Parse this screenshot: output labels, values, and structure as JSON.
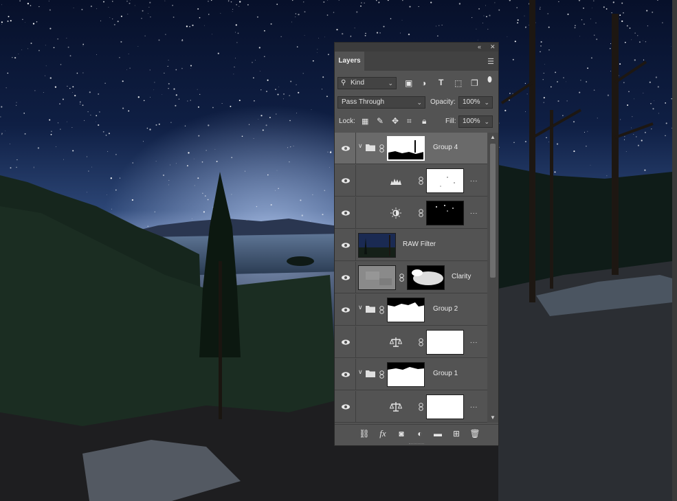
{
  "canvas": {
    "description_icon": "photo-night-lake-milky-way"
  },
  "panel": {
    "tab_label": "Layers",
    "collapse_icon": "double-chevron-left-icon",
    "close_icon": "close-icon",
    "menu_icon": "panel-menu-icon",
    "filter": {
      "kind_label": "Kind"
    },
    "blend_mode": "Pass Through",
    "opacity_label": "Opacity:",
    "opacity_value": "100%",
    "lock_label": "Lock:",
    "fill_label": "Fill:",
    "fill_value": "100%",
    "layers": [
      {
        "name": "Group 4",
        "type": "group",
        "selected": true
      },
      {
        "name": "",
        "type": "levels",
        "more": "..."
      },
      {
        "name": "",
        "type": "brightness",
        "more": "..."
      },
      {
        "name": "RAW Filter",
        "type": "smart"
      },
      {
        "name": "Clarity",
        "type": "masked-pixel"
      },
      {
        "name": "Group 2",
        "type": "group"
      },
      {
        "name": "",
        "type": "balance",
        "more": "..."
      },
      {
        "name": "Group 1",
        "type": "group"
      },
      {
        "name": "",
        "type": "balance",
        "more": "..."
      }
    ],
    "bottom_icons": [
      "link-layers-icon",
      "fx-icon",
      "add-mask-icon",
      "adjustment-icon",
      "new-group-icon",
      "new-layer-icon",
      "delete-icon"
    ],
    "fx_label": "fx"
  },
  "colors": {
    "panel_bg": "#535353",
    "selected_row": "#6a6a6a",
    "sky_top": "#0b1430",
    "sky_horizon": "#3d5c8a"
  }
}
